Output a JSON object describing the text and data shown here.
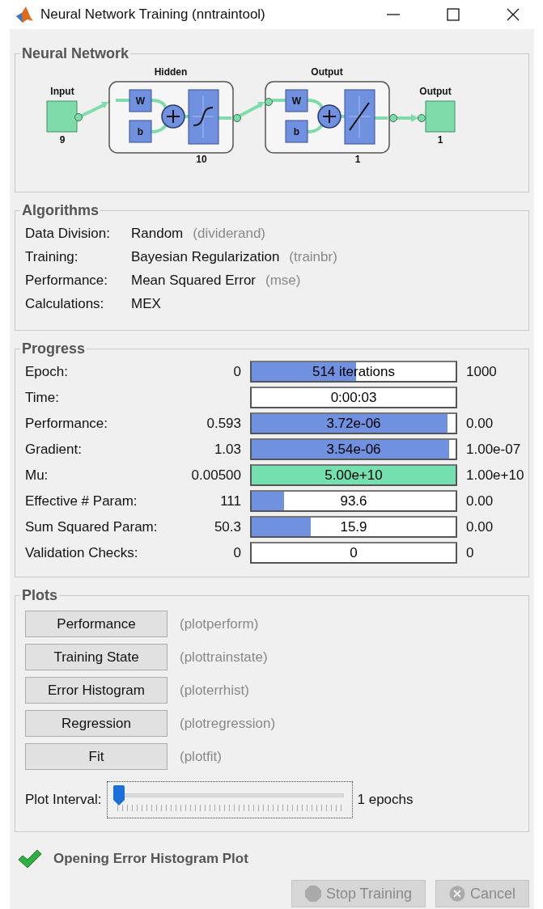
{
  "window": {
    "title": "Neural Network Training (nntraintool)"
  },
  "network": {
    "title": "Neural Network",
    "input": {
      "label": "Input",
      "size": "9"
    },
    "layers": [
      {
        "label": "Hidden",
        "weight": "W",
        "bias": "b",
        "size": "10",
        "kind": "sigmoid"
      },
      {
        "label": "Output",
        "weight": "W",
        "bias": "b",
        "size": "1",
        "kind": "linear"
      }
    ],
    "output": {
      "label": "Output",
      "size": "1"
    }
  },
  "algorithms": {
    "title": "Algorithms",
    "rows": [
      {
        "label": "Data Division:",
        "value": "Random",
        "function": "(dividerand)"
      },
      {
        "label": "Training:",
        "value": "Bayesian Regularization",
        "function": "(trainbr)"
      },
      {
        "label": "Performance:",
        "value": "Mean Squared Error",
        "function": "(mse)"
      },
      {
        "label": "Calculations:",
        "value": "MEX"
      }
    ]
  },
  "progress": {
    "title": "Progress",
    "rows": [
      {
        "label": "Epoch:",
        "start": "0",
        "value": "514 iterations",
        "end": "1000",
        "level": 0.51,
        "color": "#7090e0"
      },
      {
        "label": "Time:",
        "value": "0:00:03"
      },
      {
        "label": "Performance:",
        "start": "0.593",
        "value": "3.72e-06",
        "end": "0.00",
        "level": 0.96,
        "color": "#7090e0"
      },
      {
        "label": "Gradient:",
        "start": "1.03",
        "value": "3.54e-06",
        "end": "1.00e-07",
        "level": 0.97,
        "color": "#7090e0"
      },
      {
        "label": "Mu:",
        "start": "0.00500",
        "value": "5.00e+10",
        "end": "1.00e+10",
        "level": 1,
        "color": "#74e0b0"
      },
      {
        "label": "Effective # Param:",
        "start": "111",
        "value": "93.6",
        "end": "0.00",
        "level": 0.16,
        "color": "#7090e0"
      },
      {
        "label": "Sum Squared Param:",
        "start": "50.3",
        "value": "15.9",
        "end": "0.00",
        "level": 0.29,
        "color": "#7090e0"
      },
      {
        "label": "Validation Checks:",
        "start": "0",
        "value": "0",
        "end": "0"
      }
    ]
  },
  "plots": {
    "title": "Plots",
    "buttons": [
      {
        "label": "Performance",
        "function": "(plotperform)"
      },
      {
        "label": "Training State",
        "function": "(plottrainstate)"
      },
      {
        "label": "Error Histogram",
        "function": "(ploterrhist)"
      },
      {
        "label": "Regression",
        "function": "(plotregression)"
      },
      {
        "label": "Fit",
        "function": "(plotfit)"
      }
    ],
    "interval": {
      "label": "Plot Interval:",
      "level": 0,
      "reading": "1 epochs"
    }
  },
  "status": {
    "message": "Opening Error Histogram Plot"
  },
  "buttons": [
    {
      "label": "Stop Training",
      "kind": "stop",
      "disabled": true
    },
    {
      "label": "Cancel",
      "kind": "cancel",
      "disabled": true
    }
  ]
}
